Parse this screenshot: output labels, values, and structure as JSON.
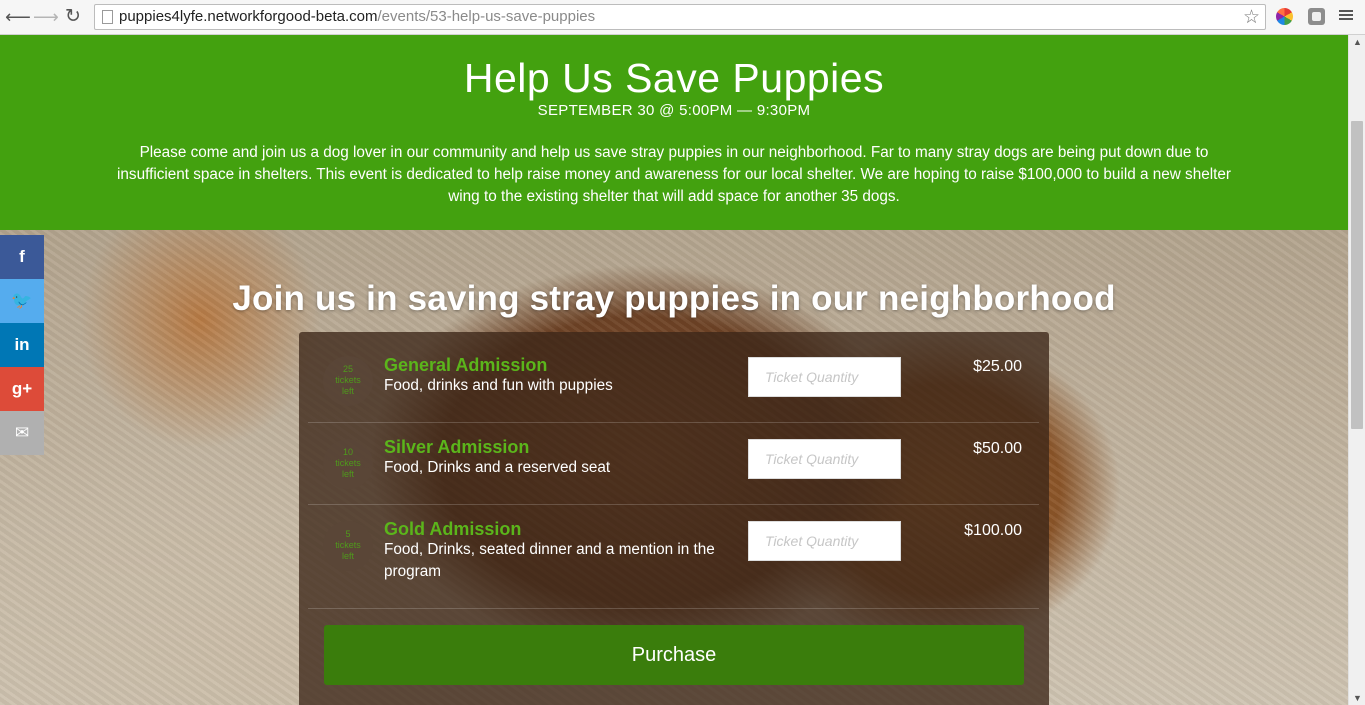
{
  "browser": {
    "url_host": "puppies4lyfe.networkforgood-beta.com",
    "url_path": "/events/53-help-us-save-puppies"
  },
  "event": {
    "title": "Help Us Save Puppies",
    "date": "SEPTEMBER 30 @ 5:00PM — 9:30PM",
    "description": "Please come and join us a dog lover in our community and help us save stray puppies in our neighborhood. Far to many stray dogs are being put down due to insufficient space in shelters. This event is dedicated to help raise money and awareness for our local shelter. We are hoping to raise $100,000 to build a new shelter wing to the existing shelter that will add space for another 35 dogs."
  },
  "heading": "Join us in saving stray puppies in our neighborhood",
  "social": {
    "facebook": "f",
    "twitter": "🐦",
    "linkedin": "in",
    "googleplus": "g+",
    "email": "✉"
  },
  "tickets": [
    {
      "left_count": "25",
      "left_label_1": "tickets",
      "left_label_2": "left",
      "name": "General Admission",
      "description": "Food, drinks and fun with puppies",
      "quantity_placeholder": "Ticket Quantity",
      "price": "$25.00"
    },
    {
      "left_count": "10",
      "left_label_1": "tickets",
      "left_label_2": "left",
      "name": "Silver Admission",
      "description": "Food, Drinks and a reserved seat",
      "quantity_placeholder": "Ticket Quantity",
      "price": "$50.00"
    },
    {
      "left_count": "5",
      "left_label_1": "tickets",
      "left_label_2": "left",
      "name": "Gold Admission",
      "description": "Food, Drinks, seated dinner and a mention in the program",
      "quantity_placeholder": "Ticket Quantity",
      "price": "$100.00"
    }
  ],
  "purchase_label": "Purchase",
  "colors": {
    "brand_green": "#43a10f",
    "ticket_name_green": "#5bb51b",
    "purchase_green": "#3a7d0c"
  }
}
